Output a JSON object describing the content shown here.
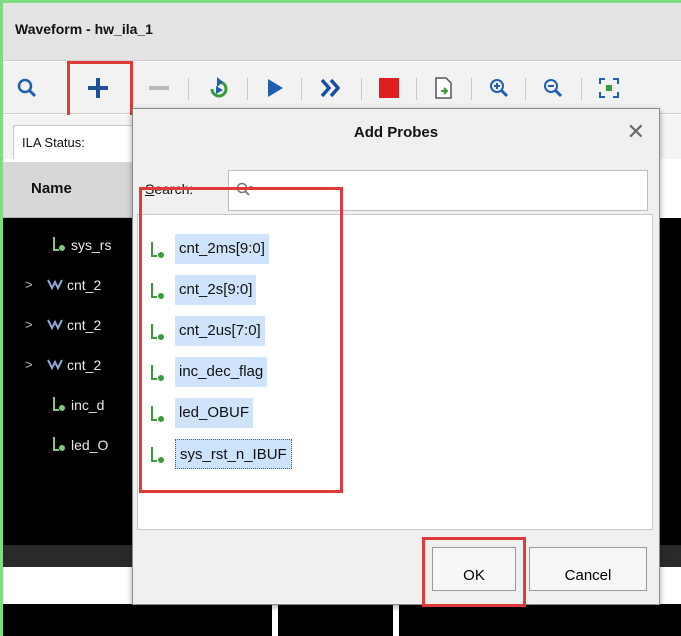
{
  "window": {
    "title": "Waveform - hw_ila_1"
  },
  "toolbar": {
    "icons": [
      "zoom-search-icon",
      "add-icon",
      "remove-icon",
      "run-trigger-icon",
      "run-icon",
      "fast-forward-icon",
      "stop-icon",
      "export-icon",
      "zoom-in-icon",
      "zoom-out-icon",
      "zoom-fit-icon"
    ]
  },
  "status_tab": {
    "label": "ILA Status:"
  },
  "signal_panel": {
    "header": "Name",
    "rows": [
      {
        "label": "sys_rs",
        "kind": "bit",
        "expandable": false
      },
      {
        "label": "cnt_2",
        "kind": "bus",
        "expandable": true
      },
      {
        "label": "cnt_2",
        "kind": "bus",
        "expandable": true
      },
      {
        "label": "cnt_2",
        "kind": "bus",
        "expandable": true
      },
      {
        "label": "inc_d",
        "kind": "bit",
        "expandable": false
      },
      {
        "label": "led_O",
        "kind": "bit",
        "expandable": false
      }
    ]
  },
  "dialog": {
    "title": "Add Probes",
    "close_symbol": "✕",
    "search_label_mnemonic": "S",
    "search_label_rest": "earch:",
    "search_value": "",
    "probes": [
      "cnt_2ms[9:0]",
      "cnt_2s[9:0]",
      "cnt_2us[7:0]",
      "inc_dec_flag",
      "led_OBUF",
      "sys_rst_n_IBUF"
    ],
    "ok_label": "OK",
    "cancel_label": "Cancel"
  },
  "colors": {
    "highlight": "#e03a3a",
    "selection": "#cfe3fb",
    "frame": "#7fdc7f",
    "probe_icon": "#3a9b3a",
    "stop": "#e01e1e",
    "play": "#1f5fae"
  }
}
